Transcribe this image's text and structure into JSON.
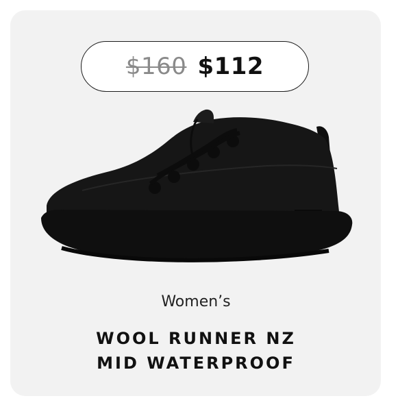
{
  "product": {
    "original_price": "$160",
    "sale_price": "$112",
    "gender": "Women’s",
    "name_line1": "WOOL RUNNER NZ",
    "name_line2": "MID WATERPROOF",
    "tag_text": "WATERPROOF",
    "image_icon": "black-mid-top-sneaker"
  },
  "colors": {
    "card_background": "#f2f2f2",
    "shoe": "#141414",
    "sale_price": "#111111",
    "original_price": "#8a8a8a"
  }
}
